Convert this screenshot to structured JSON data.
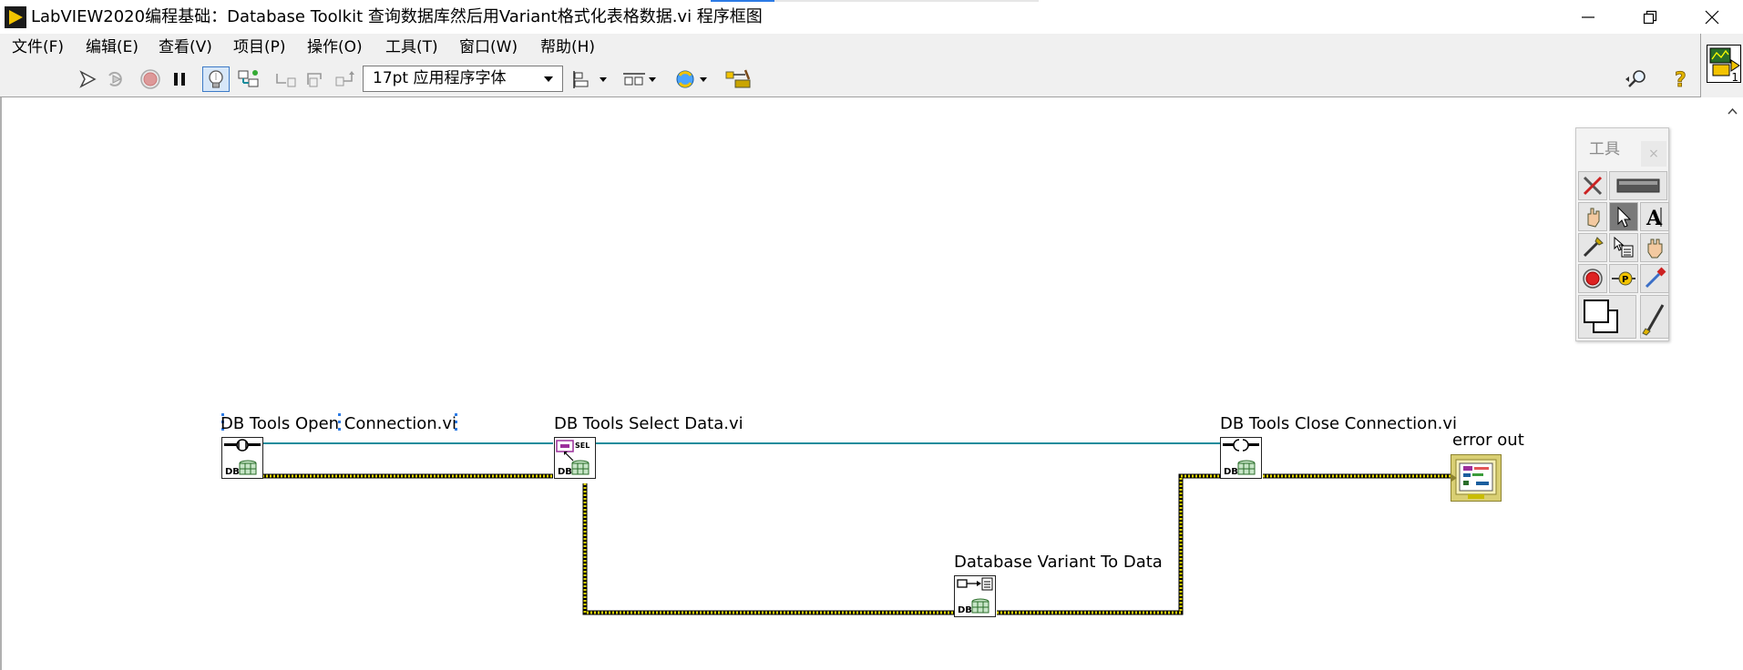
{
  "window": {
    "title": "LabVIEW2020编程基础：Database Toolkit 查询数据库然后用Variant格式化表格数据.vi 程序框图"
  },
  "menu": [
    {
      "label": "文件(F)"
    },
    {
      "label": "编辑(E)"
    },
    {
      "label": "查看(V)"
    },
    {
      "label": "项目(P)"
    },
    {
      "label": "操作(O)"
    },
    {
      "label": "工具(T)"
    },
    {
      "label": "窗口(W)"
    },
    {
      "label": "帮助(H)"
    }
  ],
  "toolbar": {
    "font_select_value": "17pt 应用程序字体",
    "icons": [
      "run-arrow-icon",
      "run-continuously-icon",
      "abort-icon",
      "pause-icon",
      "highlight-execution-icon",
      "retain-wire-values-icon",
      "step-into-icon",
      "step-over-icon",
      "step-out-icon",
      "align-objects-icon",
      "distribute-objects-icon",
      "reorder-icon",
      "cleanup-diagram-icon",
      "search-icon",
      "help-icon"
    ]
  },
  "connector": {
    "icon_number": "1"
  },
  "diagram": {
    "nodes": [
      {
        "label": "DB Tools Open Connection.vi",
        "icon": "db-open-connection-icon"
      },
      {
        "label": "DB Tools Select Data.vi",
        "icon": "db-select-data-icon"
      },
      {
        "label": "DB Tools Close Connection.vi",
        "icon": "db-close-connection-icon"
      },
      {
        "label": "Database Variant To Data",
        "icon": "db-variant-to-data-icon"
      },
      {
        "label": "error out",
        "icon": "error-cluster-indicator-icon"
      }
    ],
    "wire_colors": {
      "refnum": "#1a8c9c",
      "error": "#c9bd00"
    }
  },
  "tools_palette": {
    "title": "工具",
    "close": "×",
    "tools": [
      "automatic-tool-icon",
      "operate-value-icon",
      "position-select-icon",
      "edit-text-icon",
      "connect-wire-icon",
      "object-shortcut-menu-icon",
      "scroll-window-icon",
      "breakpoint-icon",
      "probe-icon",
      "get-color-icon",
      "set-color-icon",
      "paintbrush-icon"
    ]
  }
}
